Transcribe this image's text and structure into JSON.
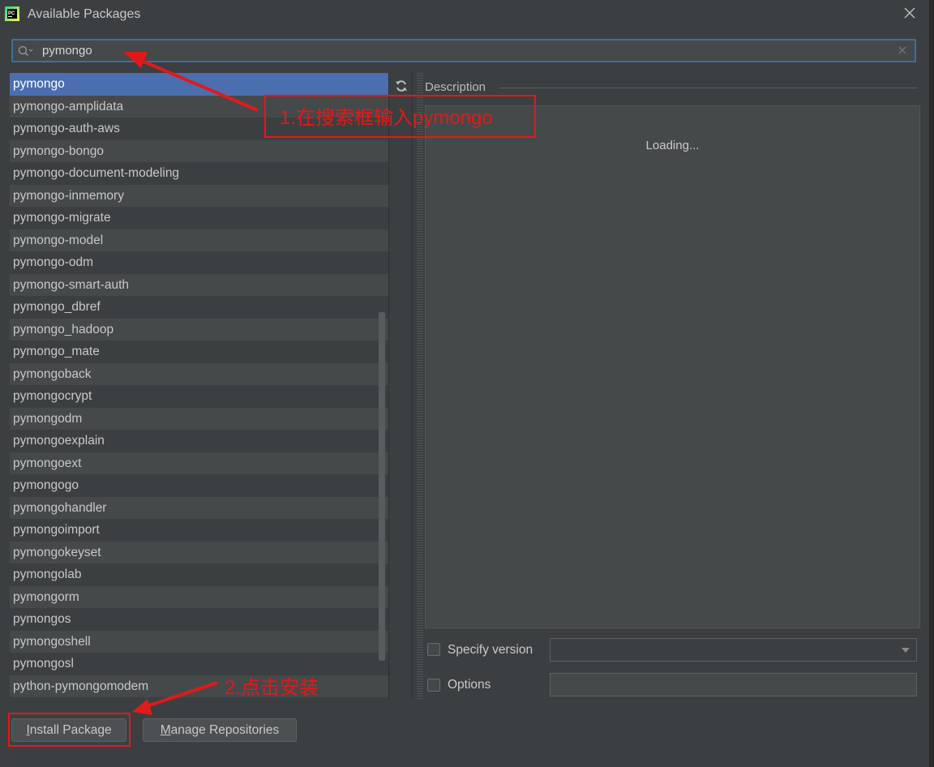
{
  "window": {
    "title": "Available Packages"
  },
  "search": {
    "value": "pymongo"
  },
  "packages": [
    "pymongo",
    "pymongo-amplidata",
    "pymongo-auth-aws",
    "pymongo-bongo",
    "pymongo-document-modeling",
    "pymongo-inmemory",
    "pymongo-migrate",
    "pymongo-model",
    "pymongo-odm",
    "pymongo-smart-auth",
    "pymongo_dbref",
    "pymongo_hadoop",
    "pymongo_mate",
    "pymongoback",
    "pymongocrypt",
    "pymongodm",
    "pymongoexplain",
    "pymongoext",
    "pymongogo",
    "pymongohandler",
    "pymongoimport",
    "pymongokeyset",
    "pymongolab",
    "pymongorm",
    "pymongos",
    "pymongoshell",
    "pymongosl",
    "python-pymongomodem"
  ],
  "selected_index": 0,
  "description": {
    "label": "Description",
    "status": "Loading..."
  },
  "specify_version": {
    "label": "Specify version",
    "checked": false,
    "value": ""
  },
  "options": {
    "label": "Options",
    "checked": false,
    "value": ""
  },
  "buttons": {
    "install_first": "I",
    "install_rest": "nstall Package",
    "manage_first": "M",
    "manage_rest": "anage Repositories"
  },
  "annotations": {
    "step1": "1.在搜索框输入pymongo",
    "step2": "2.点击安装",
    "color": "#e01a1a"
  },
  "colors": {
    "selection": "#4b6eaf",
    "background": "#3c3f41",
    "focus": "#3d6fa0"
  },
  "icons": [
    "pycharm-app-icon",
    "close-icon",
    "search-icon",
    "clear-icon",
    "refresh-icon",
    "chevron-down-icon"
  ]
}
